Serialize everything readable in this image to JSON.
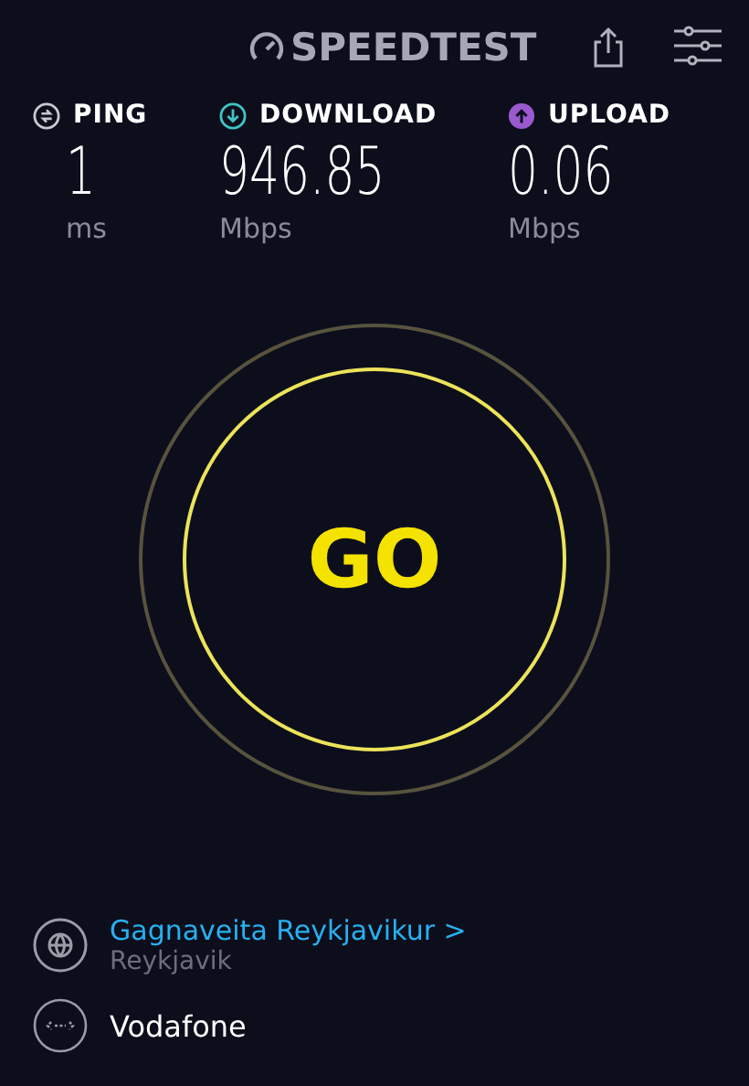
{
  "header": {
    "logo": "SPEEDTEST"
  },
  "metrics": [
    {
      "kind": "ping",
      "label": "PING",
      "value": "1",
      "unit": "ms",
      "color": "#c8c8d0"
    },
    {
      "kind": "download",
      "label": "DOWNLOAD",
      "value": "946.85",
      "unit": "Mbps",
      "color": "#40c4c4"
    },
    {
      "kind": "upload",
      "label": "UPLOAD",
      "value": "0.06",
      "unit": "Mbps",
      "color": "#9b59d0"
    }
  ],
  "go_button": {
    "label": "GO"
  },
  "server": {
    "name": "Gagnaveita Reykjavikur",
    "chevron": ">",
    "location": "Reykjavik"
  },
  "provider": {
    "name": "Vodafone"
  }
}
